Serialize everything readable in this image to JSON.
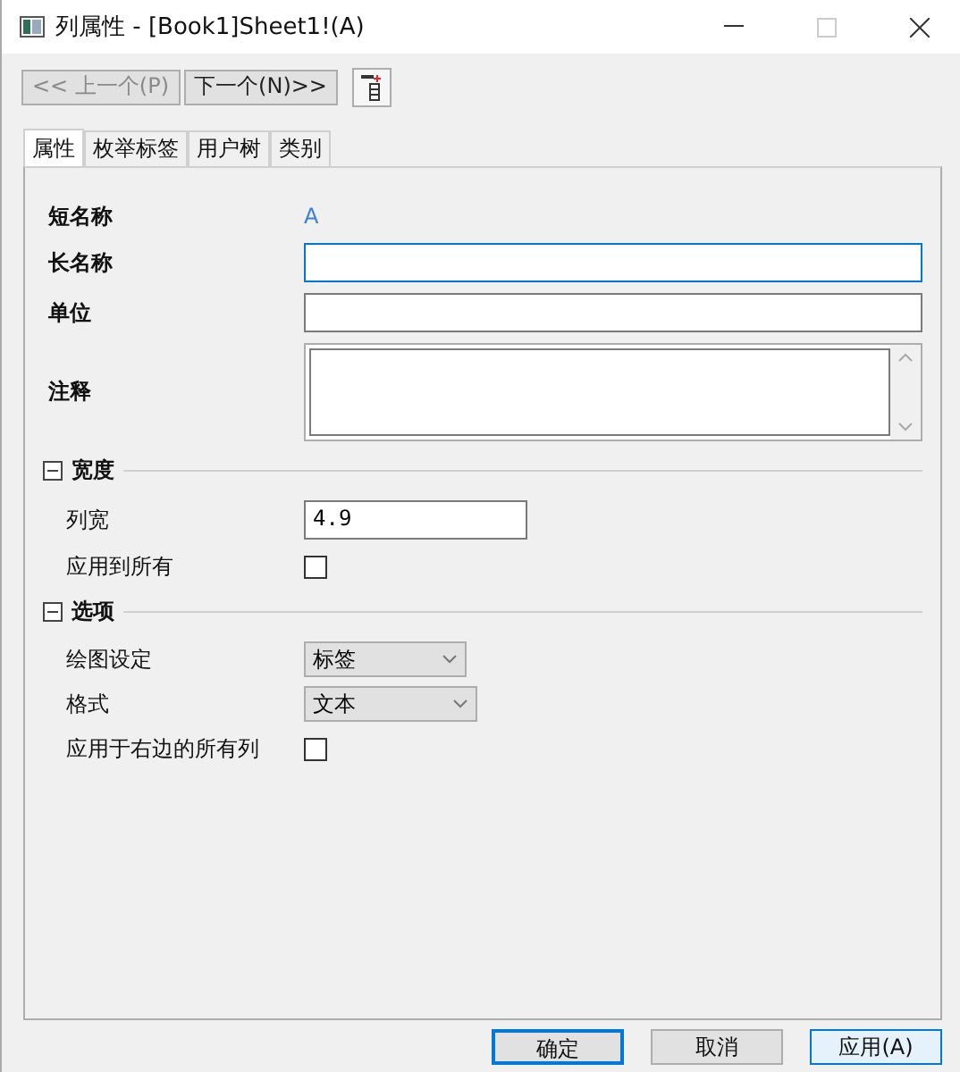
{
  "window": {
    "title": "列属性 - [Book1]Sheet1!(A)"
  },
  "nav": [
    {
      "label": "<< 上一个(P)",
      "disabled": true
    },
    {
      "label": "下一个(N)>>",
      "disabled": false
    }
  ],
  "tabs": [
    {
      "label": "属性",
      "selected": true
    },
    {
      "label": "枚举标签",
      "selected": false
    },
    {
      "label": "用户树",
      "selected": false
    },
    {
      "label": "类别",
      "selected": false
    }
  ],
  "fields": [
    {
      "kind": "static",
      "label": "短名称",
      "value": "A"
    },
    {
      "kind": "text",
      "label": "长名称",
      "focused": true
    },
    {
      "kind": "text",
      "label": "单位",
      "focused": false
    },
    {
      "kind": "memo",
      "label": "注释"
    }
  ],
  "sections": [
    {
      "title": "宽度",
      "expanded": true,
      "items": [
        {
          "kind": "text",
          "label": "列宽",
          "value": "4.9"
        },
        {
          "kind": "check",
          "label": "应用到所有",
          "checked": false
        }
      ]
    },
    {
      "title": "选项",
      "expanded": true,
      "items": [
        {
          "kind": "select",
          "label": "绘图设定",
          "value": "标签"
        },
        {
          "kind": "select",
          "label": "格式",
          "value": "文本"
        },
        {
          "kind": "check",
          "label": "应用于右边的所有列",
          "checked": false
        }
      ]
    }
  ],
  "buttons": [
    {
      "label": "确定",
      "kind": "default"
    },
    {
      "label": "取消",
      "kind": "normal"
    },
    {
      "label": "应用(A)",
      "kind": "hot"
    }
  ]
}
